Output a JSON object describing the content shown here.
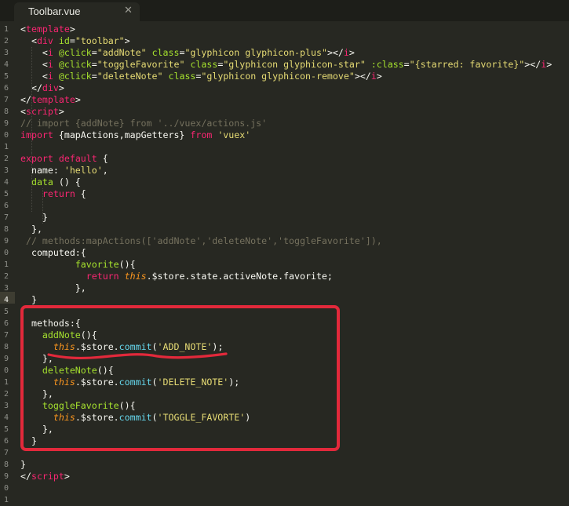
{
  "tab": {
    "title": "Toolbar.vue",
    "close_glyph": "✕"
  },
  "gutter_lines": [
    "1",
    "2",
    "3",
    "4",
    "5",
    "6",
    "7",
    "8",
    "9",
    "0",
    "1",
    "2",
    "3",
    "4",
    "5",
    "6",
    "7",
    "8",
    "9",
    "0",
    "1",
    "2",
    "3",
    "4",
    "5",
    "6",
    "7",
    "8",
    "9",
    "0",
    "1",
    "2",
    "3",
    "4",
    "5",
    "6",
    "7",
    "8",
    "9",
    "0",
    "1"
  ],
  "code_lines": [
    [
      [
        "<",
        "p"
      ],
      [
        "template",
        "t"
      ],
      [
        ">",
        "p"
      ]
    ],
    [
      [
        "  <",
        "p"
      ],
      [
        "div",
        "t"
      ],
      [
        " ",
        "p"
      ],
      [
        "id",
        "a"
      ],
      [
        "=",
        "p"
      ],
      [
        "\"toolbar\"",
        "s"
      ],
      [
        ">",
        "p"
      ]
    ],
    [
      [
        "    <",
        "p"
      ],
      [
        "i",
        "t"
      ],
      [
        " ",
        "p"
      ],
      [
        "@click",
        "a"
      ],
      [
        "=",
        "p"
      ],
      [
        "\"addNote\"",
        "s"
      ],
      [
        " ",
        "p"
      ],
      [
        "class",
        "a"
      ],
      [
        "=",
        "p"
      ],
      [
        "\"glyphicon glyphicon-plus\"",
        "s"
      ],
      [
        "></",
        "p"
      ],
      [
        "i",
        "t"
      ],
      [
        ">",
        "p"
      ]
    ],
    [
      [
        "    <",
        "p"
      ],
      [
        "i",
        "t"
      ],
      [
        " ",
        "p"
      ],
      [
        "@click",
        "a"
      ],
      [
        "=",
        "p"
      ],
      [
        "\"toggleFavorite\"",
        "s"
      ],
      [
        " ",
        "p"
      ],
      [
        "class",
        "a"
      ],
      [
        "=",
        "p"
      ],
      [
        "\"glyphicon glyphicon-star\"",
        "s"
      ],
      [
        " ",
        "p"
      ],
      [
        ":class",
        "a"
      ],
      [
        "=",
        "p"
      ],
      [
        "\"{starred: favorite}\"",
        "s"
      ],
      [
        "></",
        "p"
      ],
      [
        "i",
        "t"
      ],
      [
        ">",
        "p"
      ]
    ],
    [
      [
        "    <",
        "p"
      ],
      [
        "i",
        "t"
      ],
      [
        " ",
        "p"
      ],
      [
        "@click",
        "a"
      ],
      [
        "=",
        "p"
      ],
      [
        "\"deleteNote\"",
        "s"
      ],
      [
        " ",
        "p"
      ],
      [
        "class",
        "a"
      ],
      [
        "=",
        "p"
      ],
      [
        "\"glyphicon glyphicon-remove\"",
        "s"
      ],
      [
        "></",
        "p"
      ],
      [
        "i",
        "t"
      ],
      [
        ">",
        "p"
      ]
    ],
    [
      [
        "  </",
        "p"
      ],
      [
        "div",
        "t"
      ],
      [
        ">",
        "p"
      ]
    ],
    [
      [
        "</",
        "p"
      ],
      [
        "template",
        "t"
      ],
      [
        ">",
        "p"
      ]
    ],
    [
      [
        "<",
        "p"
      ],
      [
        "script",
        "t"
      ],
      [
        ">",
        "p"
      ]
    ],
    [
      [
        "// import {addNote} from '../vuex/actions.js'",
        "c"
      ]
    ],
    [
      [
        "import",
        "k"
      ],
      [
        " {mapActions,mapGetters} ",
        "p"
      ],
      [
        "from",
        "k"
      ],
      [
        " ",
        "p"
      ],
      [
        "'vuex'",
        "s"
      ]
    ],
    [],
    [
      [
        "export",
        "k"
      ],
      [
        " ",
        "p"
      ],
      [
        "default",
        "k"
      ],
      [
        " {",
        "p"
      ]
    ],
    [
      [
        "  name: ",
        "p"
      ],
      [
        "'hello'",
        "s"
      ],
      [
        ",",
        "p"
      ]
    ],
    [
      [
        "  ",
        "p"
      ],
      [
        "data",
        "a"
      ],
      [
        " () {",
        "p"
      ]
    ],
    [
      [
        "    ",
        "p"
      ],
      [
        "return",
        "k"
      ],
      [
        " {",
        "p"
      ]
    ],
    [],
    [
      [
        "    }",
        "p"
      ]
    ],
    [
      [
        "  },",
        "p"
      ]
    ],
    [
      [
        " // methods:mapActions(['addNote','deleteNote','toggleFavorite']),",
        "c"
      ]
    ],
    [
      [
        "  computed:{",
        "p"
      ]
    ],
    [
      [
        "          ",
        "p"
      ],
      [
        "favorite",
        "a"
      ],
      [
        "(){",
        "p"
      ]
    ],
    [
      [
        "            ",
        "p"
      ],
      [
        "return",
        "k"
      ],
      [
        " ",
        "p"
      ],
      [
        "this",
        "v"
      ],
      [
        ".$store.state.activeNote.favorite;",
        "p"
      ]
    ],
    [
      [
        "          },",
        "p"
      ]
    ],
    [
      [
        "  }",
        "p"
      ]
    ],
    [],
    [
      [
        "  methods:{",
        "p"
      ]
    ],
    [
      [
        "    ",
        "p"
      ],
      [
        "addNote",
        "a"
      ],
      [
        "(){",
        "p"
      ]
    ],
    [
      [
        "      ",
        "p"
      ],
      [
        "this",
        "v"
      ],
      [
        ".$store.",
        "p"
      ],
      [
        "commit",
        "f"
      ],
      [
        "(",
        "p"
      ],
      [
        "'ADD_NOTE'",
        "s"
      ],
      [
        ");",
        "p"
      ]
    ],
    [
      [
        "    },",
        "p"
      ]
    ],
    [
      [
        "    ",
        "p"
      ],
      [
        "deleteNote",
        "a"
      ],
      [
        "(){",
        "p"
      ]
    ],
    [
      [
        "      ",
        "p"
      ],
      [
        "this",
        "v"
      ],
      [
        ".$store.",
        "p"
      ],
      [
        "commit",
        "f"
      ],
      [
        "(",
        "p"
      ],
      [
        "'DELETE_NOTE'",
        "s"
      ],
      [
        ");",
        "p"
      ]
    ],
    [
      [
        "    },",
        "p"
      ]
    ],
    [
      [
        "    ",
        "p"
      ],
      [
        "toggleFavorite",
        "a"
      ],
      [
        "(){",
        "p"
      ]
    ],
    [
      [
        "      ",
        "p"
      ],
      [
        "this",
        "v"
      ],
      [
        ".$store.",
        "p"
      ],
      [
        "commit",
        "f"
      ],
      [
        "(",
        "p"
      ],
      [
        "'TOGGLE_FAVORTE'",
        "s"
      ],
      [
        ")",
        "p"
      ]
    ],
    [
      [
        "    },",
        "p"
      ]
    ],
    [
      [
        "  }",
        "p"
      ]
    ],
    [],
    [
      [
        "}",
        "p"
      ]
    ],
    [
      [
        "</",
        "p"
      ],
      [
        "script",
        "t"
      ],
      [
        ">",
        "p"
      ]
    ]
  ],
  "current_line_index": 23,
  "colors": {
    "background": "#272822",
    "tag": "#f92672",
    "attribute": "#a6e22e",
    "string": "#e6db74",
    "comment": "#75715e",
    "this": "#fd971f",
    "function": "#66d9ef",
    "annotation": "#e2293b"
  }
}
